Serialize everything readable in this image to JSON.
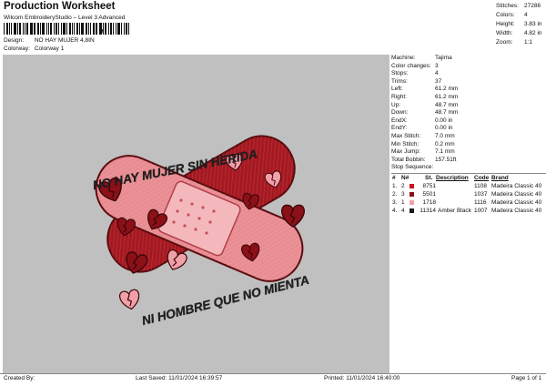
{
  "header": {
    "title": "Production Worksheet",
    "subtitle": "Wilcom EmbroideryStudio – Level 3 Advanced",
    "barcode_mark": ",",
    "design_label": "Design:",
    "design_value": "NO HAY MUJER 4,8IN",
    "colorway_label": "Colorway:",
    "colorway_value": "Colorway 1"
  },
  "summary": [
    {
      "label": "Stitches:",
      "value": "27286"
    },
    {
      "label": "Colors:",
      "value": "4"
    },
    {
      "label": "Height:",
      "value": "3.83 in"
    },
    {
      "label": "Width:",
      "value": "4.82 in"
    },
    {
      "label": "Zoom:",
      "value": "1:1"
    }
  ],
  "specs": [
    {
      "label": "Machine:",
      "value": "Tajima"
    },
    {
      "label": "Color changes:",
      "value": "3"
    },
    {
      "label": "Stops:",
      "value": "4"
    },
    {
      "label": "Trims:",
      "value": "37"
    },
    {
      "label": "Left:",
      "value": "61.2 mm"
    },
    {
      "label": "Right:",
      "value": "61.2 mm"
    },
    {
      "label": "Up:",
      "value": "48.7 mm"
    },
    {
      "label": "Down:",
      "value": "48.7 mm"
    },
    {
      "label": "EndX:",
      "value": "0.00 in"
    },
    {
      "label": "EndY:",
      "value": "0.00 in"
    },
    {
      "label": "Max Stitch:",
      "value": "7.0 mm"
    },
    {
      "label": "Min Stitch:",
      "value": "0.2 mm"
    },
    {
      "label": "Max Jump:",
      "value": "7.1 mm"
    },
    {
      "label": "Total Bobbin:",
      "value": "157.51ft"
    }
  ],
  "stop_sequence": {
    "title": "Stop Sequence:",
    "headers": {
      "stop": "#",
      "needle": "N#",
      "st": "St.",
      "description": "Description",
      "code": "Code",
      "brand": "Brand"
    },
    "rows": [
      {
        "stop": "1.",
        "needle": "2",
        "color": "#c8141e",
        "st": "8751",
        "description": "",
        "code": "1108",
        "brand": "Madeira Classic 40"
      },
      {
        "stop": "2.",
        "needle": "3",
        "color": "#8b1018",
        "st": "5501",
        "description": "",
        "code": "1037",
        "brand": "Madeira Classic 40"
      },
      {
        "stop": "3.",
        "needle": "1",
        "color": "#f2a0a8",
        "st": "1718",
        "description": "",
        "code": "1116",
        "brand": "Madeira Classic 40"
      },
      {
        "stop": "4.",
        "needle": "4",
        "color": "#1a1a1a",
        "st": "11314",
        "description": "Amber Black",
        "code": "1007",
        "brand": "Madeira Classic 40"
      }
    ]
  },
  "design": {
    "text_top": "NO HAY MUJER SIN HERIDA",
    "text_bottom": "NI HOMBRE QUE NO MIENTA",
    "colors": {
      "red": "#c8141e",
      "dark_red": "#8b1018",
      "pink": "#f2a0a8",
      "black": "#1a1a1a",
      "background": "#c0c0c0"
    }
  },
  "footer": {
    "created_by": "Created By:",
    "last_saved": "Last Saved: 11/01/2024 16:39:57",
    "printed": "Printed: 11/01/2024 16:40:00",
    "page": "Page 1 of 1"
  }
}
